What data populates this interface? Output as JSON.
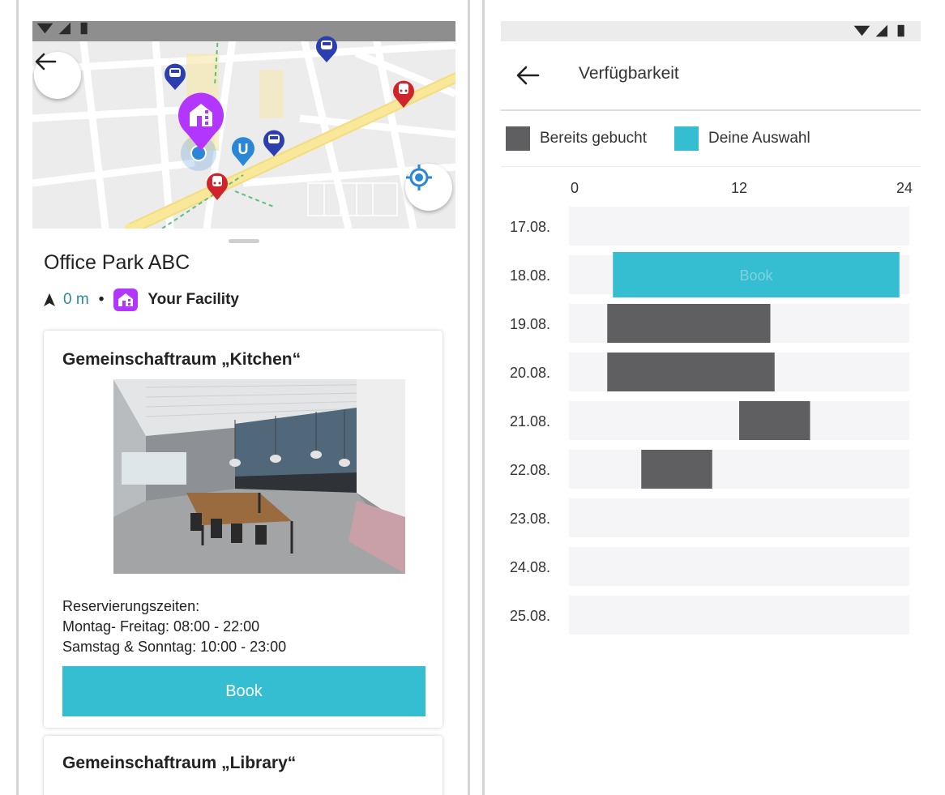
{
  "left_screen": {
    "map": {
      "back_icon": "arrow-left-icon",
      "locate_icon": "my-location-icon",
      "markers": [
        "bus-stop-icon",
        "bus-stop-icon",
        "bus-stop-icon",
        "train-station-icon",
        "train-station-icon",
        "subway-u-icon",
        "facility-pin-icon",
        "current-location-icon"
      ],
      "subway_label": "U"
    },
    "place": {
      "title": "Office Park ABC",
      "distance": "0 m",
      "separator": "•",
      "facility_label": "Your Facility"
    },
    "cards": [
      {
        "title": "Gemeinschaftraum „Kitchen“",
        "hours_heading": "Reservierungszeiten:",
        "hours_weekday": "Montag- Freitag: 08:00 - 22:00",
        "hours_weekend": "Samstag & Sonntag: 10:00 - 23:00",
        "book_label": "Book"
      },
      {
        "title": "Gemeinschaftraum „Library“"
      }
    ]
  },
  "right_screen": {
    "title": "Verfügbarkeit",
    "legend": [
      {
        "label": "Bereits gebucht",
        "color": "#5f5f61"
      },
      {
        "label": "Deine Auswahl",
        "color": "#35bed2"
      }
    ]
  },
  "colors": {
    "accent": "#35bed2",
    "booked": "#5f5f61",
    "facility": "#b336ff",
    "row_bg": "#f5f5f8"
  },
  "chart_data": {
    "type": "bar",
    "orientation": "horizontal-range",
    "axis_ticks": [
      "0",
      "12",
      "24"
    ],
    "xlim": [
      0,
      24
    ],
    "categories": [
      "17.08.",
      "18.08.",
      "19.08.",
      "20.08.",
      "21.08.",
      "22.08.",
      "23.08.",
      "24.08.",
      "25.08."
    ],
    "series": [
      {
        "name": "Bereits gebucht",
        "color": "#5f5f61",
        "ranges": [
          {
            "day": "19.08.",
            "start": 2.7,
            "end": 14.2
          },
          {
            "day": "20.08.",
            "start": 2.7,
            "end": 14.5
          },
          {
            "day": "21.08.",
            "start": 12.0,
            "end": 17.0
          },
          {
            "day": "22.08.",
            "start": 5.1,
            "end": 10.1
          }
        ]
      },
      {
        "name": "Deine Auswahl",
        "color": "#35bed2",
        "ranges": [
          {
            "day": "18.08.",
            "start": 3.1,
            "end": 23.3,
            "label": "Book"
          }
        ]
      }
    ]
  }
}
